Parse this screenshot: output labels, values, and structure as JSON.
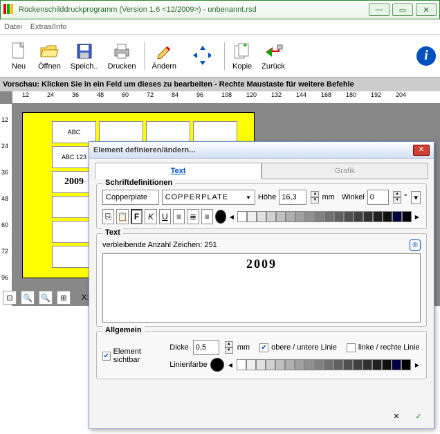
{
  "window": {
    "title": "Rückenschilddruckprogramm (Version 1.6 <12/2009>) - unbenannt.rsd"
  },
  "menu": {
    "datei": "Datei",
    "extras": "Extras/Info"
  },
  "toolbar": {
    "neu": "Neu",
    "oeffnen": "Öffnen",
    "speichern": "Speich..",
    "drucken": "Drucken",
    "aendern": "Ändern",
    "kopie": "Kopie",
    "zurueck": "Zurück"
  },
  "preview_hint": "Vorschau: Klicken Sie in ein Feld um dieses zu bearbeiten - Rechte Maustaste für weitere Befehle",
  "ruler_h": [
    "12",
    "24",
    "36",
    "48",
    "60",
    "72",
    "84",
    "96",
    "108",
    "120",
    "132",
    "144",
    "168",
    "180",
    "192",
    "204"
  ],
  "ruler_v": [
    "12",
    "24",
    "36",
    "48",
    "60",
    "72",
    "96"
  ],
  "labels": {
    "c0": "ABC",
    "c1": "ABC\n123",
    "c2": "2009"
  },
  "zoombar": {
    "x_label": "X:"
  },
  "dialog": {
    "title": "Element definieren/ändern...",
    "tab_text": "Text",
    "tab_grafik": "Grafik",
    "section_font": "Schriftdefinitionen",
    "font_name": "Copperplate",
    "font_sample": "COPPERPLATE",
    "hoehe_label": "Höhe",
    "hoehe_value": "16,3",
    "mm": "mm",
    "winkel_label": "Winkel",
    "winkel_value": "0",
    "deg": "°",
    "section_text": "Text",
    "remaining": "verbleibende Anzahl Zeichen: 251",
    "text_content": "2009",
    "section_allg": "Allgemein",
    "sichtbar": "Element sichtbar",
    "dicke_label": "Dicke",
    "dicke_value": "0,5",
    "obere": "obere / untere Linie",
    "linke": "linke / rechte Linie",
    "linienfarbe": "Linienfarbe"
  },
  "grays": [
    "#ffffff",
    "#f0f0f0",
    "#e0e0e0",
    "#d0d0d0",
    "#c0c0c0",
    "#b0b0b0",
    "#a0a0a0",
    "#909090",
    "#808080",
    "#707070",
    "#606060",
    "#505050",
    "#404040",
    "#303030",
    "#202020",
    "#101010",
    "#000040",
    "#000000"
  ]
}
